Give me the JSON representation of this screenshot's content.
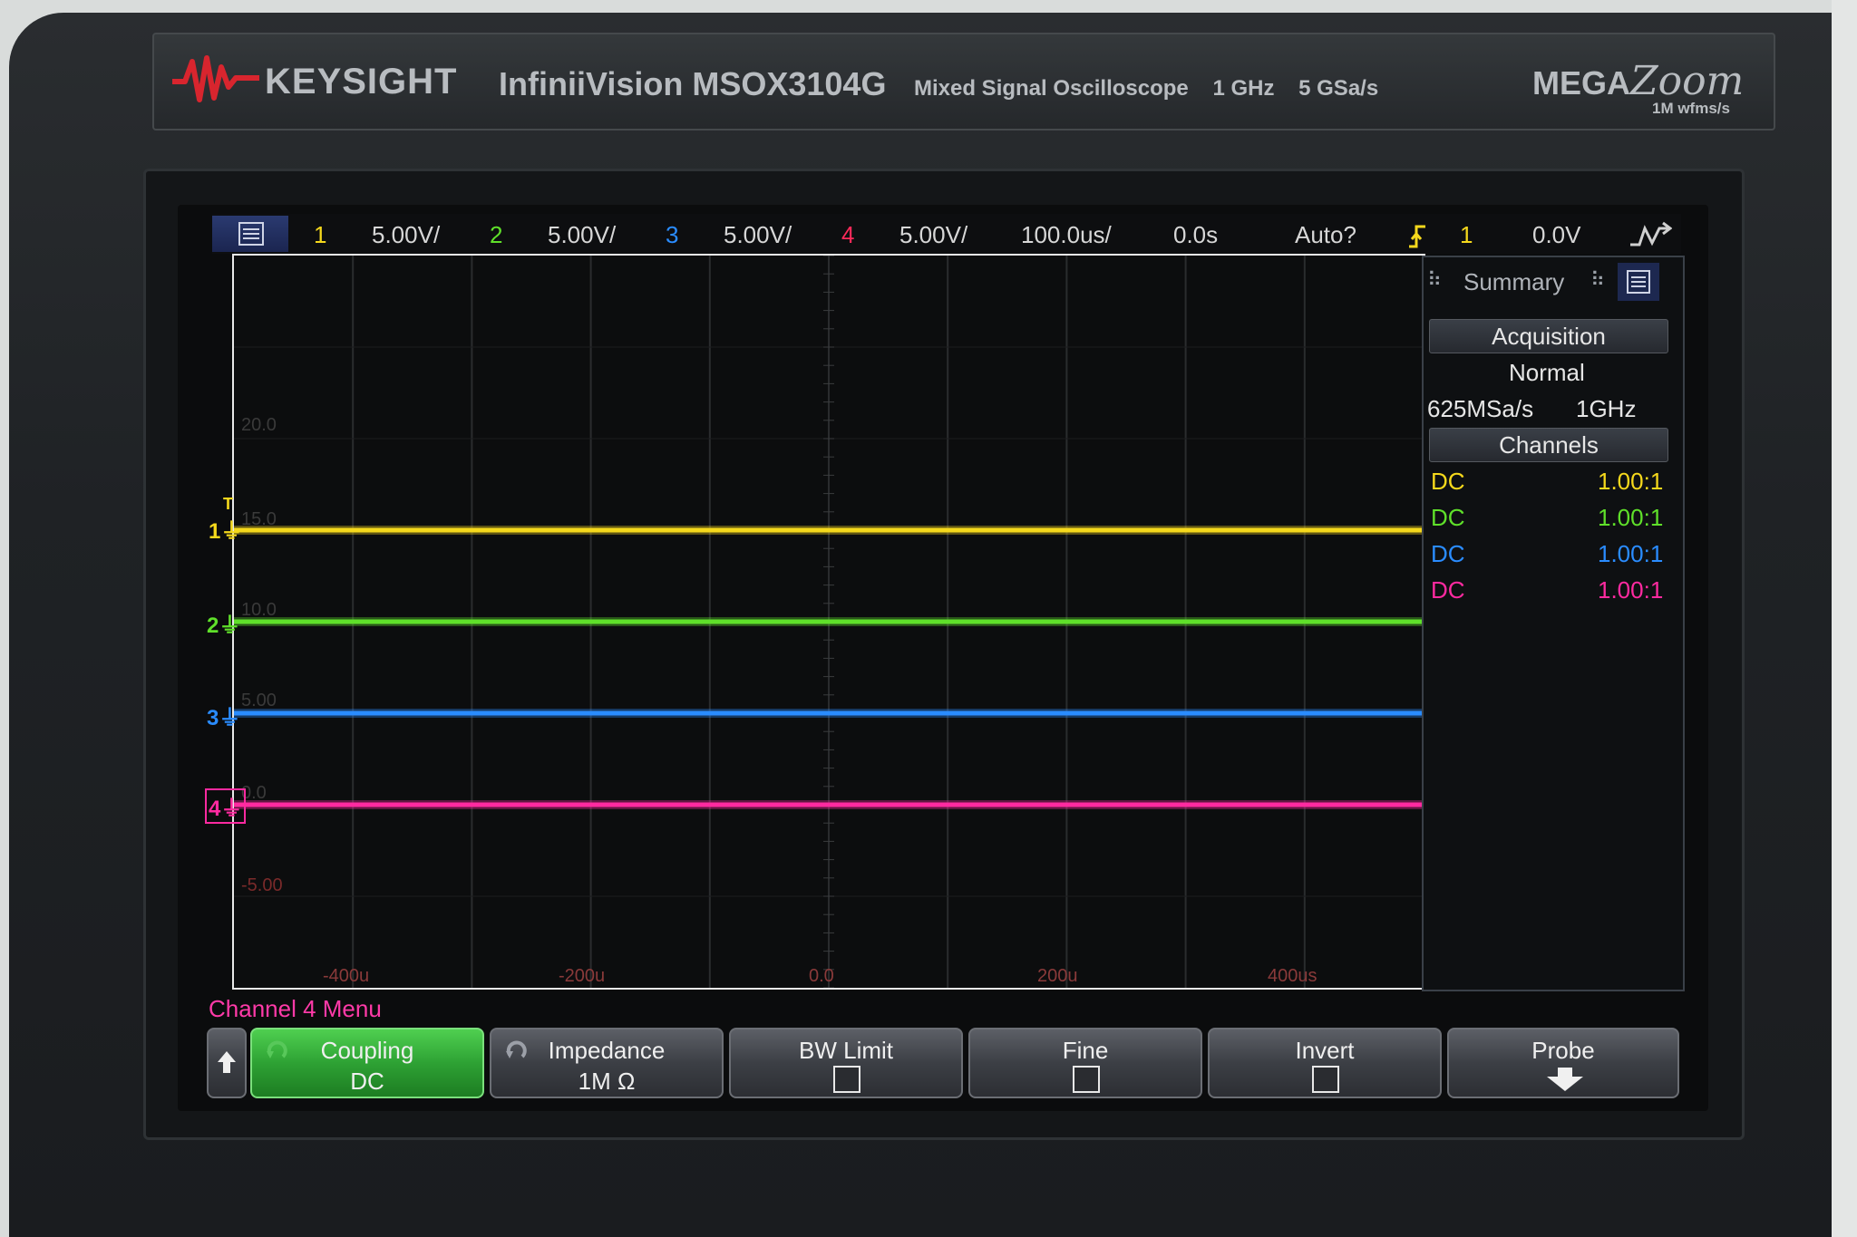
{
  "header": {
    "brand": "KEYSIGHT",
    "model": "InfiniiVision MSOX3104G",
    "description": "Mixed Signal Oscilloscope",
    "bandwidth": "1 GHz",
    "sample_rate": "5 GSa/s",
    "megazoom_prefix": "MEGA",
    "megazoom_suffix": "Zoom",
    "megazoom_sub": "1M wfms/s"
  },
  "status_bar": {
    "ch1_num": "1",
    "ch1_scale": "5.00V/",
    "ch2_num": "2",
    "ch2_scale": "5.00V/",
    "ch3_num": "3",
    "ch3_scale": "5.00V/",
    "ch4_num": "4",
    "ch4_scale": "5.00V/",
    "timebase": "100.0us/",
    "delay": "0.0s",
    "trigger_mode": "Auto?",
    "trigger_source": "1",
    "trigger_level": "0.0V"
  },
  "grid": {
    "y_labels": [
      "20.0",
      "15.0",
      "10.0",
      "5.00",
      "0.0",
      "-5.00"
    ],
    "x_labels": [
      "-400u",
      "-200u",
      "0.0",
      "200u",
      "400us"
    ]
  },
  "channels": [
    {
      "marker": "1",
      "color": "#f5d81c",
      "level_div": -1.0
    },
    {
      "marker": "2",
      "color": "#5fe02a",
      "level_div": 0.0
    },
    {
      "marker": "3",
      "color": "#2a8cff",
      "level_div": 1.0
    },
    {
      "marker": "4",
      "color": "#ff2aa0",
      "level_div": 2.0
    }
  ],
  "summary": {
    "title": "Summary",
    "acquisition_header": "Acquisition",
    "acquisition_mode": "Normal",
    "acq_rate": "625MSa/s",
    "acq_bw": "1GHz",
    "channels_header": "Channels",
    "rows": [
      {
        "coupling": "DC",
        "probe": "1.00:1",
        "color": "#f5d81c"
      },
      {
        "coupling": "DC",
        "probe": "1.00:1",
        "color": "#5fe02a"
      },
      {
        "coupling": "DC",
        "probe": "1.00:1",
        "color": "#2a8cff"
      },
      {
        "coupling": "DC",
        "probe": "1.00:1",
        "color": "#ff2aa0"
      }
    ]
  },
  "menu": {
    "title": "Channel 4 Menu",
    "coupling_label": "Coupling",
    "coupling_value": "DC",
    "impedance_label": "Impedance",
    "impedance_value": "1M Ω",
    "bwlimit_label": "BW Limit",
    "fine_label": "Fine",
    "invert_label": "Invert",
    "probe_label": "Probe"
  }
}
